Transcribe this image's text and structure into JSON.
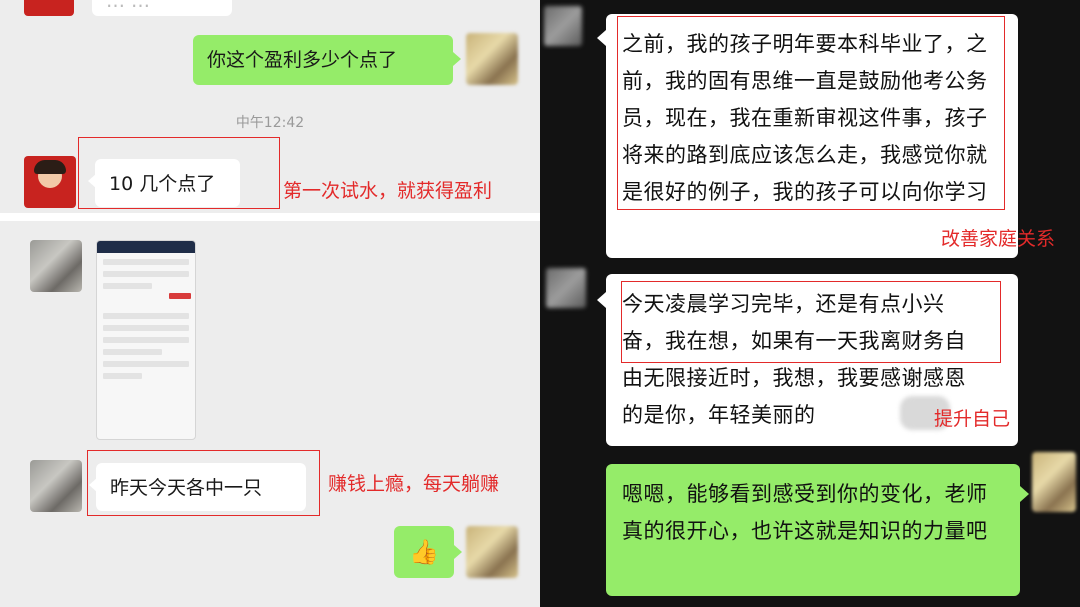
{
  "left_top": {
    "partial_msg": "… …",
    "msg_question": "你这个盈利多少个点了",
    "timestamp": "中午12:42",
    "msg_answer": "10 几个点了",
    "annotation": "第一次试水，就获得盈利"
  },
  "left_bottom": {
    "msg_answer": "昨天今天各中一只",
    "annotation": "赚钱上瘾，每天躺赚",
    "reply_emoji": "👍"
  },
  "right": {
    "msg1": "之前，我的孩子明年要本科毕业了，之前，我的固有思维一直是鼓励他考公务员，现在，我在重新审视这件事，孩子将来的路到底应该怎么走，我感觉你就是很好的例子，我的孩子可以向你学习",
    "annotation1": "改善家庭关系",
    "msg2": "今天凌晨学习完毕，还是有点小兴奋，我在想，如果有一天我离财务自由无限接近时，我想，我要感谢感恩的是你，年轻美丽的",
    "annotation2": "提升自己",
    "msg3": "嗯嗯，能够看到感受到你的变化，老师真的很开心，也许这就是知识的力量吧"
  },
  "colors": {
    "bubble_green": "#95ec69",
    "annotation_red": "#e32a2a",
    "chat_bg": "#ededed",
    "right_bg": "#121212"
  }
}
